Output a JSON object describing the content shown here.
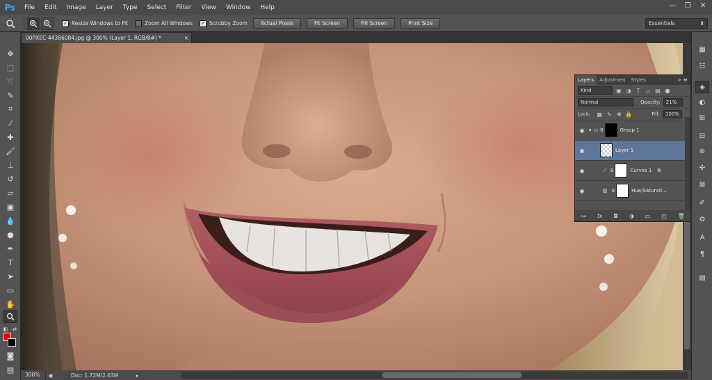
{
  "app": {
    "logo": "Ps"
  },
  "menu": [
    "File",
    "Edit",
    "Image",
    "Layer",
    "Type",
    "Select",
    "Filter",
    "View",
    "Window",
    "Help"
  ],
  "options": {
    "resize_windows": "Resize Windows to Fit",
    "zoom_all": "Zoom All Windows",
    "scrubby_zoom": "Scrubby Zoom",
    "actual_pixels": "Actual Pixels",
    "fit_screen": "Fit Screen",
    "fill_screen": "Fill Screen",
    "print_size": "Print Size",
    "workspace": "Essentials",
    "resize_checked": true,
    "zoom_all_checked": false,
    "scrubby_checked": true
  },
  "document": {
    "tab_title": "00PXEC-44386084.jpg @ 300% (Layer 1, RGB/8#) *"
  },
  "status": {
    "zoom": "300%",
    "doc": "Doc: 1.72M/2.63M"
  },
  "layers_panel": {
    "tabs": [
      "Layers",
      "Adjustmen",
      "Styles"
    ],
    "kind": "Kind",
    "blend_mode": "Normal",
    "opacity_label": "Opacity:",
    "opacity": "21%",
    "lock_label": "Lock:",
    "fill_label": "Fill:",
    "fill": "100%",
    "layers": [
      {
        "name": "Group 1"
      },
      {
        "name": "Layer 1"
      },
      {
        "name": "Curves 1"
      },
      {
        "name": "Hue/Saturati..."
      }
    ]
  },
  "colors": {
    "foreground": "#f20000",
    "background": "#000000",
    "selected_layer": "#5e7799",
    "accent": "#31a8ff"
  }
}
